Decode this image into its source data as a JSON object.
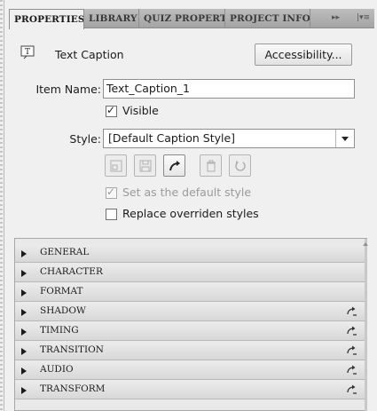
{
  "tabs": [
    {
      "label": "PROPERTIES",
      "active": true
    },
    {
      "label": "LIBRARY",
      "active": false
    },
    {
      "label": "QUIZ PROPERTIES",
      "active": false
    },
    {
      "label": "PROJECT INFO",
      "active": false
    }
  ],
  "tab_controls": {
    "expand": "▸▸",
    "menu": "|▾≡"
  },
  "header": {
    "item_type": "Text Caption",
    "accessibility_label": "Accessibility..."
  },
  "item_name": {
    "label": "Item Name:",
    "value": "Text_Caption_1"
  },
  "visible": {
    "label": "Visible",
    "checked": true
  },
  "style": {
    "label": "Style:",
    "value": "[Default Caption Style]"
  },
  "style_buttons": [
    {
      "icon": "new-style-icon",
      "enabled": false
    },
    {
      "icon": "save-icon",
      "enabled": false
    },
    {
      "icon": "redo-icon",
      "enabled": true
    },
    {
      "icon": "trash-icon",
      "enabled": false
    },
    {
      "icon": "reset-icon",
      "enabled": false
    }
  ],
  "default_style": {
    "label": "Set as the default style",
    "checked": true,
    "enabled": false
  },
  "replace_overridden": {
    "label": "Replace overriden styles",
    "checked": false
  },
  "sections": [
    {
      "label": "GENERAL",
      "has_reset": false
    },
    {
      "label": "CHARACTER",
      "has_reset": false
    },
    {
      "label": "FORMAT",
      "has_reset": false
    },
    {
      "label": "SHADOW",
      "has_reset": true
    },
    {
      "label": "TIMING",
      "has_reset": true
    },
    {
      "label": "TRANSITION",
      "has_reset": true
    },
    {
      "label": "AUDIO",
      "has_reset": true
    },
    {
      "label": "TRANSFORM",
      "has_reset": true
    }
  ],
  "colors": {
    "panel_bg": "#f0f0f0",
    "tab_bar": "#b0b0b0",
    "accordion_row": "#dcdcdc"
  }
}
